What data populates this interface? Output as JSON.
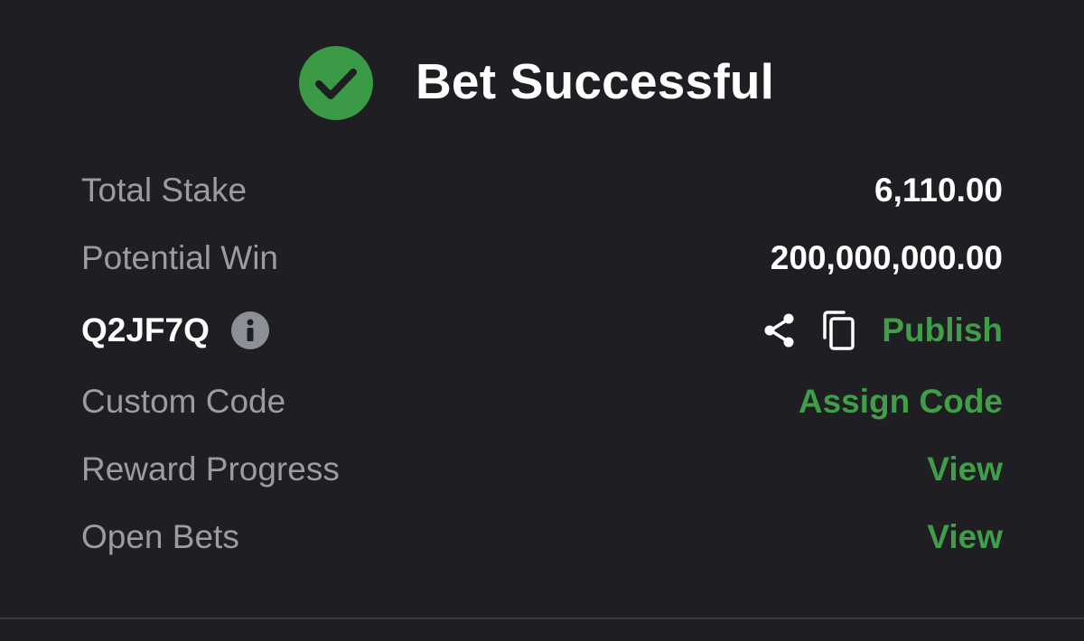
{
  "header": {
    "title": "Bet Successful",
    "icon": "check-circle-icon",
    "accent_color": "#3a9a45"
  },
  "summary": {
    "total_stake": {
      "label": "Total Stake",
      "value": "6,110.00"
    },
    "potential_win": {
      "label": "Potential Win",
      "value": "200,000,000.00"
    },
    "booking": {
      "code": "Q2JF7Q",
      "info_icon": "info-icon",
      "share_icon": "share-icon",
      "copy_icon": "copy-icon",
      "publish_label": "Publish"
    },
    "custom_code": {
      "label": "Custom Code",
      "action": "Assign Code"
    },
    "reward_progress": {
      "label": "Reward Progress",
      "action": "View"
    },
    "open_bets": {
      "label": "Open Bets",
      "action": "View"
    }
  },
  "colors": {
    "background": "#1f1f23",
    "label_gray": "#9a9ba3",
    "link_green": "#3f9e47"
  }
}
